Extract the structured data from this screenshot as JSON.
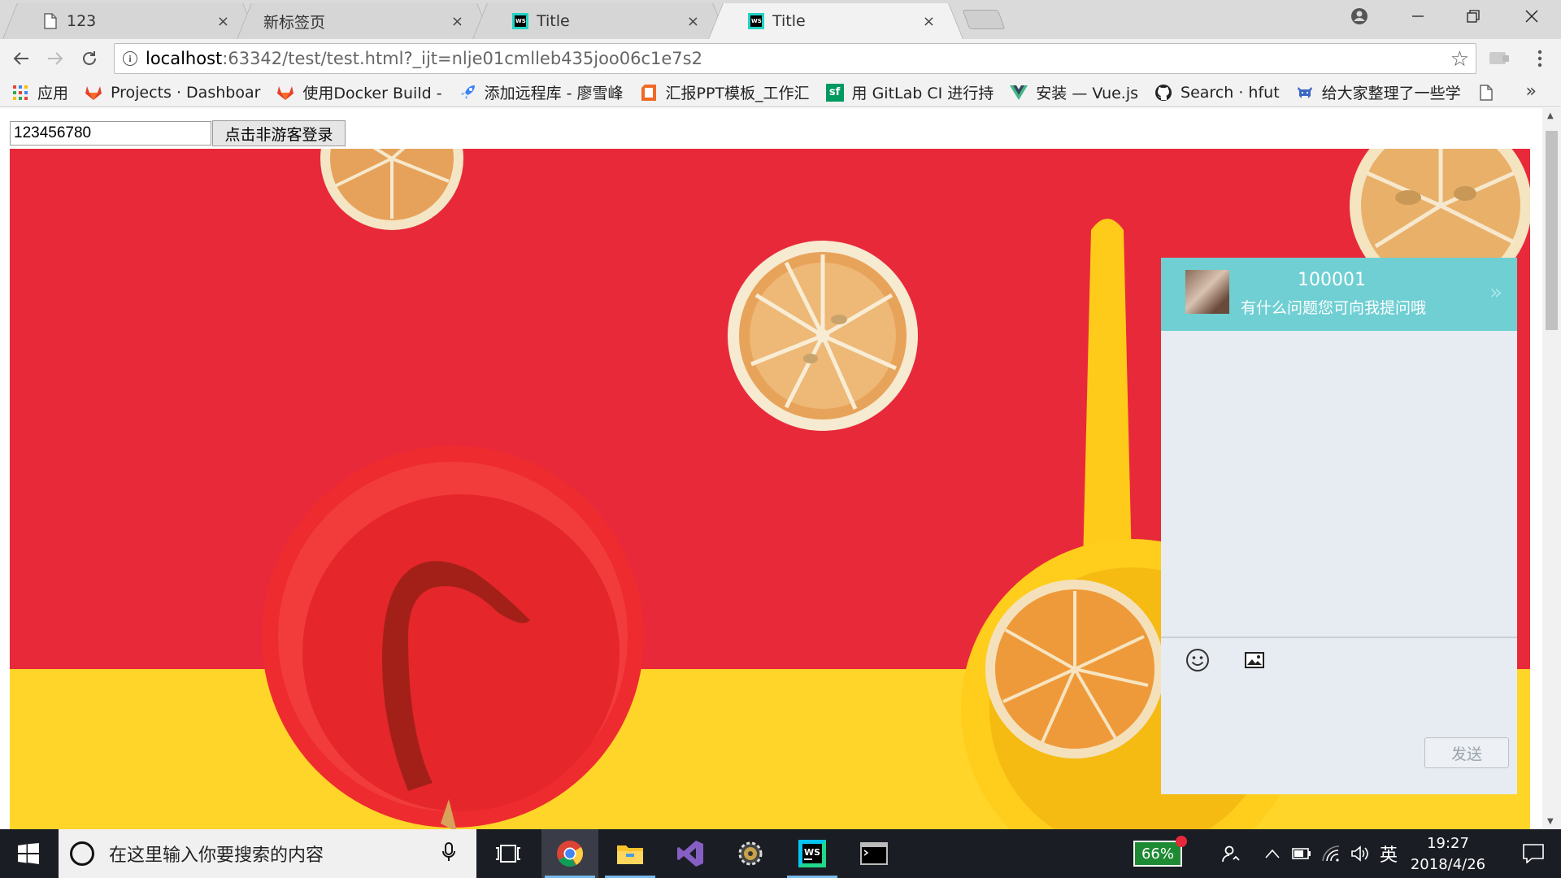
{
  "browser": {
    "tabs": [
      {
        "title": "123",
        "icon": "page-icon"
      },
      {
        "title": "新标签页",
        "icon": "none"
      },
      {
        "title": "Title",
        "icon": "webstorm-icon"
      },
      {
        "title": "Title",
        "icon": "webstorm-icon"
      }
    ],
    "tab_close": "×",
    "url_host": "localhost",
    "url_rest": ":63342/test/test.html?_ijt=nlje01cmlleb435joo06c1e7s2",
    "bookmarks": [
      {
        "label": "应用",
        "icon": "apps-grid-icon"
      },
      {
        "label": "Projects · Dashboar",
        "icon": "gitlab-icon"
      },
      {
        "label": "使用Docker Build -",
        "icon": "gitlab-icon"
      },
      {
        "label": "添加远程库 - 廖雪峰",
        "icon": "rocket-icon"
      },
      {
        "label": "汇报PPT模板_工作汇",
        "icon": "ppt-icon"
      },
      {
        "label": "用 GitLab CI 进行持",
        "icon": "segmentfault-icon"
      },
      {
        "label": "安装 — Vue.js",
        "icon": "vue-icon"
      },
      {
        "label": "Search · hfut",
        "icon": "github-icon"
      },
      {
        "label": "给大家整理了一些学",
        "icon": "invader-icon"
      }
    ],
    "bookmarks_more": "»"
  },
  "page": {
    "login_input_value": "123456780",
    "login_button": "点击非游客登录",
    "chat": {
      "id": "100001",
      "subtitle": "有什么问题您可向我提问哦",
      "collapse": "»",
      "send_label": "发送"
    }
  },
  "taskbar": {
    "search_placeholder": "在这里输入你要搜索的内容",
    "battery": "66%",
    "ime": "英",
    "time": "19:27",
    "date": "2018/4/26"
  },
  "colors": {
    "chat_header": "#6fcfd3",
    "chat_body": "#e7ecf2",
    "background_red": "#e8293a",
    "background_yellow": "#ffd52a"
  }
}
